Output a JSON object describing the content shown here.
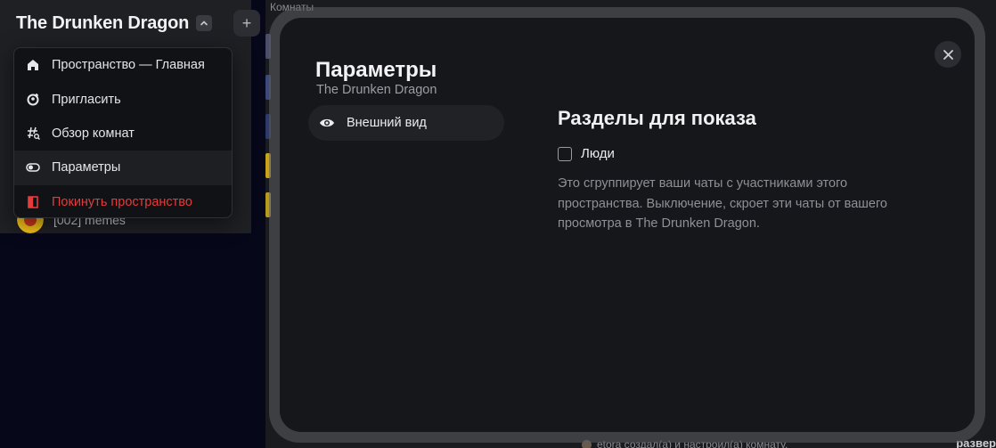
{
  "space": {
    "title": "The Drunken Dragon",
    "add_label": "+"
  },
  "background": {
    "room_name": "[002] memes",
    "rooms_header": "Комнаты",
    "footer_event": "etora создал(а) и настроил(а) комнату.",
    "footer_right": "развер"
  },
  "menu": {
    "items": [
      {
        "label": "Пространство — Главная",
        "icon": "home-icon"
      },
      {
        "label": "Пригласить",
        "icon": "invite-icon"
      },
      {
        "label": "Обзор комнат",
        "icon": "explore-rooms-icon"
      },
      {
        "label": "Параметры",
        "icon": "settings-toggle-icon"
      },
      {
        "label": "Покинуть пространство",
        "icon": "leave-icon"
      }
    ],
    "danger_color": "#e53b3b"
  },
  "modal": {
    "title": "Параметры",
    "subtitle": "The Drunken Dragon",
    "tab_label": "Внешний вид",
    "section_title": "Разделы для показа",
    "checkbox_label": "Люди",
    "checkbox_checked": false,
    "description": "Это сгруппирует ваши чаты с участниками этого пространства. Выключение, скроет эти чаты от вашего просмотра в The Drunken Dragon."
  }
}
